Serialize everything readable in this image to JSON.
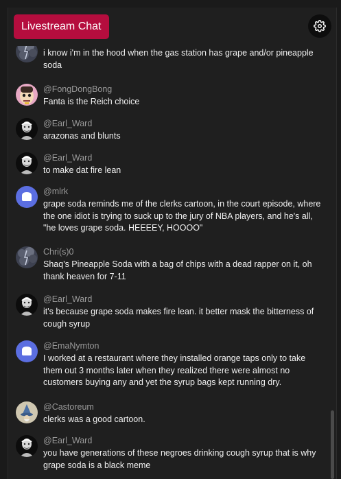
{
  "header": {
    "title": "Livestream Chat",
    "settings_icon": "gear-icon"
  },
  "colors": {
    "accent": "#b50d3e",
    "panel": "#1f1f1f",
    "username": "#9a9a9a",
    "text": "#efefef"
  },
  "messages": [
    {
      "user": "",
      "text": "i know i'm in the hood when the gas station has grape and/or pineapple soda",
      "avatar": "storm-avatar"
    },
    {
      "user": "@FongDongBong",
      "text": "Fanta is the Reich choice",
      "avatar": "cartoon-face-avatar"
    },
    {
      "user": "@Earl_Ward",
      "text": "arazonas and blunts",
      "avatar": "sketch-portrait-avatar"
    },
    {
      "user": "@Earl_Ward",
      "text": "to make dat fire lean",
      "avatar": "sketch-portrait-avatar"
    },
    {
      "user": "@mlrk",
      "text": "grape soda reminds me of the clerks cartoon, in the court episode, where the one idiot is trying to suck up to the jury of NBA players, and he's all, \"he loves grape soda. HEEEEY, HOOOO\"",
      "avatar": "default-bubble-avatar"
    },
    {
      "user": "Chri(s)0",
      "text": "Shaq's Pineapple Soda with a bag of chips with a dead rapper on it, oh thank heaven for 7-11",
      "avatar": "storm-avatar"
    },
    {
      "user": "@Earl_Ward",
      "text": "it's because grape soda makes fire lean. it better mask the bitterness of cough syrup",
      "avatar": "sketch-portrait-avatar"
    },
    {
      "user": "@EmaNymton",
      "text": "I worked at a restaurant where they installed orange taps only to take them out 3 months later when they realized there were almost no customers buying any and yet the syrup bags kept running dry.",
      "avatar": "default-bubble-avatar"
    },
    {
      "user": "@Castoreum",
      "text": "clerks was a good cartoon.",
      "avatar": "wizard-avatar"
    },
    {
      "user": "@Earl_Ward",
      "text": "you have generations of these negroes drinking cough syrup that is why grape soda is a black meme",
      "avatar": "sketch-portrait-avatar"
    }
  ]
}
